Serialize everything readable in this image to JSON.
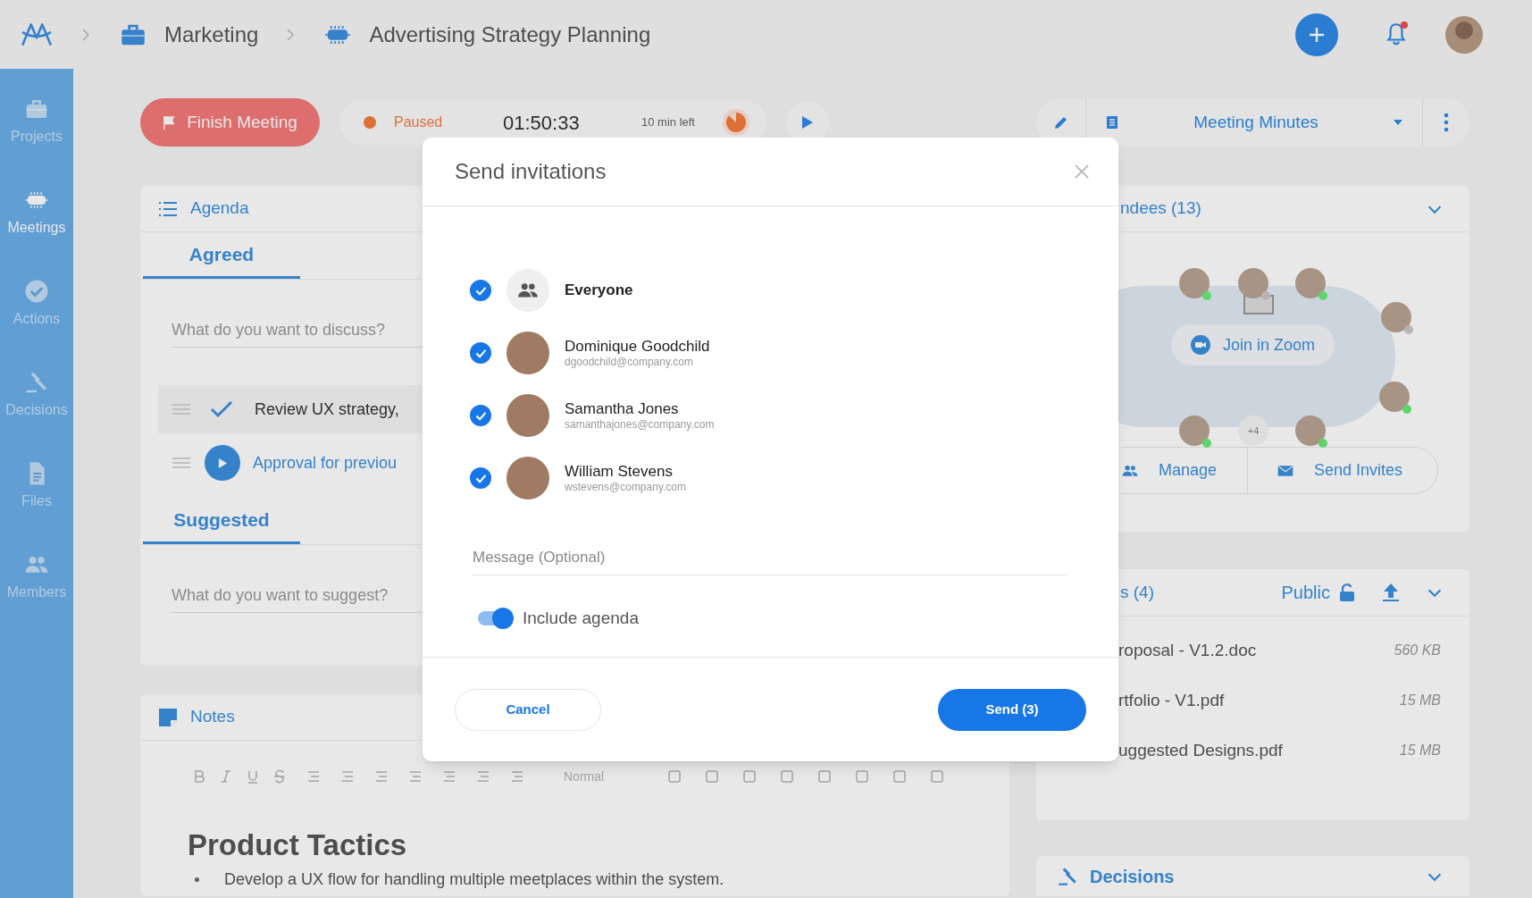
{
  "breadcrumb": [
    {
      "label": "Marketing",
      "kind": "project"
    },
    {
      "label": "Advertising Strategy Planning",
      "kind": "meeting"
    }
  ],
  "header": {
    "unread_notifications": true
  },
  "sidebar": {
    "items": [
      {
        "label": "Projects",
        "kind": "project",
        "selected": false
      },
      {
        "label": "Meetings",
        "kind": "meeting",
        "selected": true
      },
      {
        "label": "Actions",
        "kind": "action",
        "selected": false
      },
      {
        "label": "Decisions",
        "kind": "decision",
        "selected": false
      },
      {
        "label": "Files",
        "kind": "file",
        "selected": false
      },
      {
        "label": "Members",
        "kind": "member",
        "selected": false
      }
    ]
  },
  "meeting_bar": {
    "finish_button": "Finish Meeting",
    "status": "Paused",
    "elapsed": "01:50:33",
    "remaining": "10 min left"
  },
  "view_select": {
    "value": "Meeting Minutes"
  },
  "agenda": {
    "title": "Agenda",
    "sections": [
      {
        "tab": "Agreed",
        "placeholder": "What do you want to discuss?",
        "items": [
          {
            "text": "Review UX strategy,",
            "kind": "done"
          },
          {
            "text": "Approval for previou",
            "kind": "current"
          }
        ]
      },
      {
        "tab": "Suggested",
        "placeholder": "What do you want to suggest?"
      }
    ]
  },
  "notes": {
    "title": "Notes",
    "style_select": "Normal",
    "heading": "Product Tactics",
    "bullets": [
      "Develop a UX flow for handling multiple meetplaces within the system."
    ]
  },
  "attendees": {
    "title": "ndees (13)",
    "join_button": "Join in Zoom",
    "overflow": "+4",
    "seats": [
      {
        "color": "#5cd66a"
      },
      {
        "color": "#b5b5b5"
      },
      {
        "color": "#5cd66a"
      },
      {
        "color": "#b5b5b5"
      },
      {
        "color": "#5cd66a"
      },
      {
        "color": "#5cd66a"
      },
      {
        "color": "#5cd66a"
      }
    ],
    "actions": [
      {
        "label": "Manage",
        "kind": "manage"
      },
      {
        "label": "Send Invites",
        "kind": "invite"
      }
    ]
  },
  "files": {
    "title": "s (4)",
    "visibility": "Public",
    "items": [
      {
        "name": "roposal - V1.2.doc",
        "size": "560 KB"
      },
      {
        "name": "rtfolio - V1.pdf",
        "size": "15 MB"
      },
      {
        "name": "uggested Designs.pdf",
        "size": "15 MB"
      }
    ]
  },
  "decisions": {
    "title": "Decisions"
  },
  "dialog": {
    "title": "Send invitations",
    "recipients": [
      {
        "name": "Everyone",
        "kind": "group",
        "checked": true
      },
      {
        "name": "Dominique Goodchild",
        "email": "dgoodchild@company.com",
        "kind": "person",
        "checked": true
      },
      {
        "name": "Samantha Jones",
        "email": "samanthajones@company.com",
        "kind": "person",
        "checked": true
      },
      {
        "name": "William Stevens",
        "email": "wstevens@company.com",
        "kind": "person",
        "checked": true
      }
    ],
    "message": {
      "placeholder": "Message (Optional)"
    },
    "include_agenda": {
      "label": "Include agenda",
      "on": true
    },
    "cancel": "Cancel",
    "send": "Send (3)"
  }
}
